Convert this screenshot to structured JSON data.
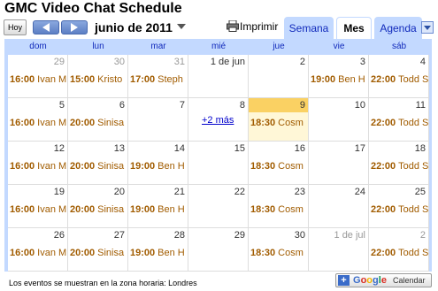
{
  "header": {
    "title": "GMC Video Chat Schedule",
    "today_label": "Hoy",
    "date_range": "junio de 2011",
    "print_label": "Imprimir"
  },
  "tabs": [
    {
      "label": "Semana",
      "active": false
    },
    {
      "label": "Mes",
      "active": true
    },
    {
      "label": "Agenda",
      "active": false
    }
  ],
  "weekdays": [
    "dom",
    "lun",
    "mar",
    "mié",
    "jue",
    "vie",
    "sáb"
  ],
  "weeks": [
    [
      {
        "day": "29",
        "muted": true,
        "event": {
          "time": "16:00",
          "title": "Ivan M"
        }
      },
      {
        "day": "30",
        "muted": true,
        "event": {
          "time": "15:00",
          "title": "Kristo"
        }
      },
      {
        "day": "31",
        "muted": true,
        "event": {
          "time": "17:00",
          "title": "Steph"
        }
      },
      {
        "day": "1 de jun",
        "muted": false
      },
      {
        "day": "2",
        "muted": false
      },
      {
        "day": "3",
        "muted": false,
        "event": {
          "time": "19:00",
          "title": "Ben H"
        }
      },
      {
        "day": "4",
        "muted": false,
        "event": {
          "time": "22:00",
          "title": "Todd S"
        }
      }
    ],
    [
      {
        "day": "5",
        "muted": false,
        "event": {
          "time": "16:00",
          "title": "Ivan M"
        }
      },
      {
        "day": "6",
        "muted": false,
        "event": {
          "time": "20:00",
          "title": "Sinisa"
        }
      },
      {
        "day": "7",
        "muted": false
      },
      {
        "day": "8",
        "muted": false,
        "more": "+2 más"
      },
      {
        "day": "9",
        "muted": false,
        "today": true,
        "event": {
          "time": "18:30",
          "title": "Cosm"
        }
      },
      {
        "day": "10",
        "muted": false
      },
      {
        "day": "11",
        "muted": false,
        "event": {
          "time": "22:00",
          "title": "Todd S"
        }
      }
    ],
    [
      {
        "day": "12",
        "muted": false,
        "event": {
          "time": "16:00",
          "title": "Ivan M"
        }
      },
      {
        "day": "13",
        "muted": false,
        "event": {
          "time": "20:00",
          "title": "Sinisa"
        }
      },
      {
        "day": "14",
        "muted": false,
        "event": {
          "time": "19:00",
          "title": "Ben H"
        }
      },
      {
        "day": "15",
        "muted": false
      },
      {
        "day": "16",
        "muted": false,
        "event": {
          "time": "18:30",
          "title": "Cosm"
        }
      },
      {
        "day": "17",
        "muted": false
      },
      {
        "day": "18",
        "muted": false,
        "event": {
          "time": "22:00",
          "title": "Todd S"
        }
      }
    ],
    [
      {
        "day": "19",
        "muted": false,
        "event": {
          "time": "16:00",
          "title": "Ivan M"
        }
      },
      {
        "day": "20",
        "muted": false,
        "event": {
          "time": "20:00",
          "title": "Sinisa"
        }
      },
      {
        "day": "21",
        "muted": false,
        "event": {
          "time": "19:00",
          "title": "Ben H"
        }
      },
      {
        "day": "22",
        "muted": false
      },
      {
        "day": "23",
        "muted": false,
        "event": {
          "time": "18:30",
          "title": "Cosm"
        }
      },
      {
        "day": "24",
        "muted": false
      },
      {
        "day": "25",
        "muted": false,
        "event": {
          "time": "22:00",
          "title": "Todd S"
        }
      }
    ],
    [
      {
        "day": "26",
        "muted": false,
        "event": {
          "time": "16:00",
          "title": "Ivan M"
        }
      },
      {
        "day": "27",
        "muted": false,
        "event": {
          "time": "20:00",
          "title": "Sinisa"
        }
      },
      {
        "day": "28",
        "muted": false,
        "event": {
          "time": "19:00",
          "title": "Ben H"
        }
      },
      {
        "day": "29",
        "muted": false
      },
      {
        "day": "30",
        "muted": false,
        "event": {
          "time": "18:30",
          "title": "Cosm"
        }
      },
      {
        "day": "1 de jul",
        "muted": true
      },
      {
        "day": "2",
        "muted": true,
        "event": {
          "time": "22:00",
          "title": "Todd S"
        }
      }
    ]
  ],
  "footer": {
    "timezone_text": "Los eventos se muestran en la zona horaria: Londres",
    "gcal_logo": "Google",
    "gcal_label": "Calendar",
    "gcal_plus": "+"
  },
  "colors": {
    "accent": "#c3d9ff",
    "event_text": "#a15c00",
    "today_header": "#fad163",
    "today_bg": "#fff7d7"
  }
}
